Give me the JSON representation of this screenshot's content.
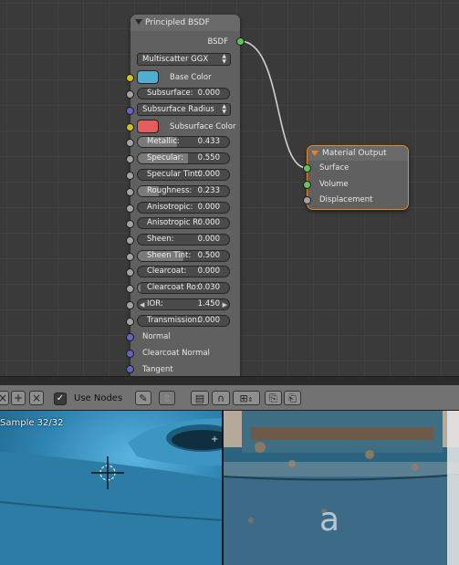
{
  "node_editor": {
    "principled_node": {
      "title": "Principled BSDF",
      "output_label": "BSDF",
      "distribution": "Multiscatter GGX",
      "base_color_label": "Base Color",
      "base_color_hex": "#52aed0",
      "subsurface": {
        "label": "Subsurface:",
        "value": "0.000",
        "fraction": 0
      },
      "subsurface_method": "Subsurface Radius",
      "subsurface_color_label": "Subsurface Color",
      "subsurface_color_hex": "#e35d5d",
      "metallic": {
        "label": "Metallic:",
        "value": "0.433",
        "fraction": 0.433
      },
      "specular": {
        "label": "Specular:",
        "value": "0.550",
        "fraction": 0.55
      },
      "specular_tint": {
        "label": "Specular Tint:",
        "value": "0.000",
        "fraction": 0
      },
      "roughness": {
        "label": "Roughness:",
        "value": "0.233",
        "fraction": 0.233
      },
      "anisotropic": {
        "label": "Anisotropic:",
        "value": "0.000",
        "fraction": 0
      },
      "anisotropic_rotation": {
        "label": "Anisotropic R:",
        "value": "0.000",
        "fraction": 0
      },
      "sheen": {
        "label": "Sheen:",
        "value": "0.000",
        "fraction": 0
      },
      "sheen_tint": {
        "label": "Sheen Tint:",
        "value": "0.500",
        "fraction": 0.5
      },
      "clearcoat": {
        "label": "Clearcoat:",
        "value": "0.000",
        "fraction": 0
      },
      "clearcoat_roughness": {
        "label": "Clearcoat Ro:",
        "value": "0.030",
        "fraction": 0.03
      },
      "ior": {
        "label": "IOR:",
        "value": "1.450"
      },
      "transmission": {
        "label": "Transmission:",
        "value": "0.000",
        "fraction": 0
      },
      "normal_label": "Normal",
      "clearcoat_normal_label": "Clearcoat Normal",
      "tangent_label": "Tangent"
    },
    "output_node": {
      "title": "Material Output",
      "surface_label": "Surface",
      "volume_label": "Volume",
      "displacement_label": "Displacement",
      "accent_color": "#e8871e"
    }
  },
  "toolbar": {
    "use_nodes_label": "Use Nodes",
    "use_nodes_checked": true,
    "icons": [
      "close-icon",
      "add-icon",
      "close-icon",
      "pin-icon",
      "parent-icon",
      "render-layer-icon",
      "snap-icon",
      "snap-element-icon",
      "copy-icon",
      "paste-icon"
    ]
  },
  "viewport": {
    "sample_text": "Sample 32/32",
    "right_label": "a"
  }
}
